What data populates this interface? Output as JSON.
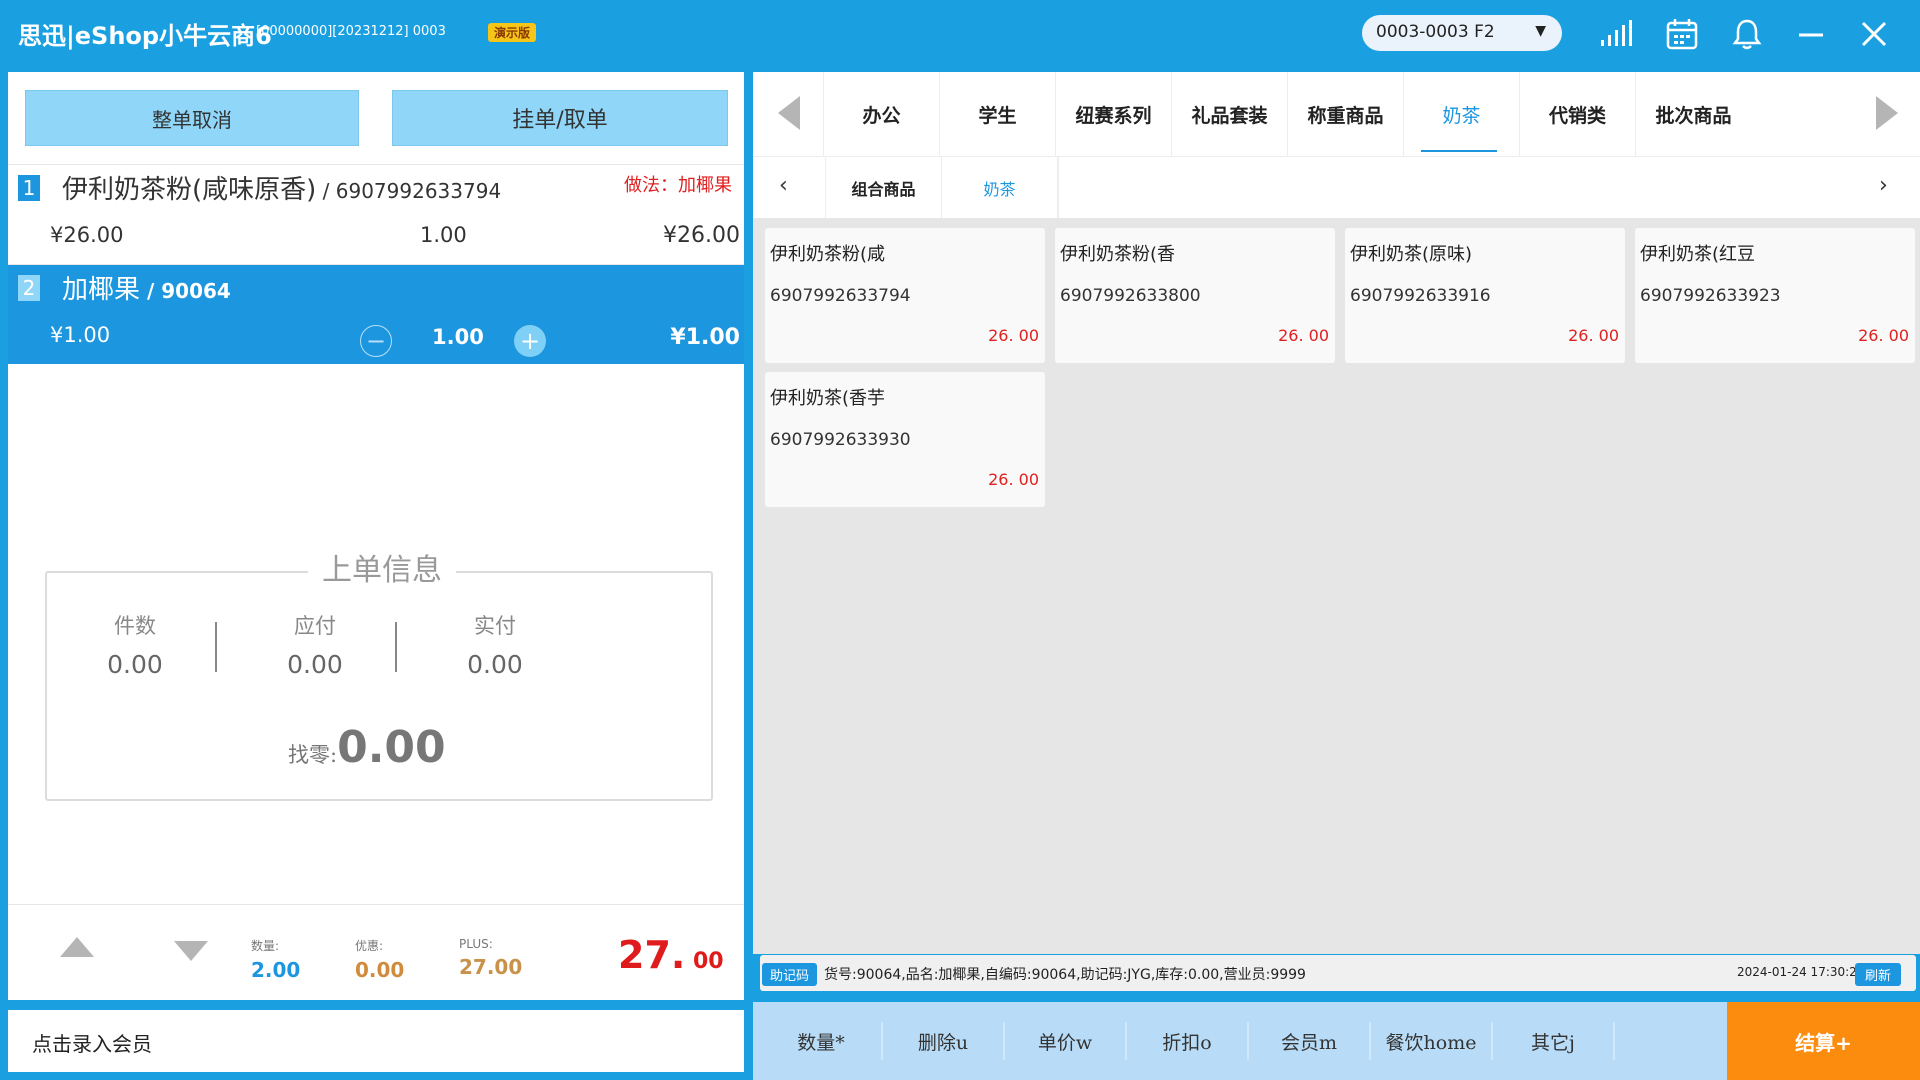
{
  "titlebar": {
    "app_title": "思迅|eShop小牛云商6",
    "meta": "[00000000][20231212]  0003",
    "demo_badge": "演示版",
    "store_select": "0003-0003 F2",
    "icons": [
      "signal-icon",
      "calendar-icon",
      "bell-icon",
      "minimize-icon",
      "close-icon"
    ]
  },
  "left": {
    "cancel_order": "整单取消",
    "hold_order": "挂单/取单",
    "order_items": [
      {
        "no": "1",
        "name": "伊利奶茶粉(咸味原香)",
        "code": " / 6907992633794",
        "note": "做法：加椰果",
        "price": "¥26.00",
        "qty": "1.00",
        "total": "¥26.00"
      },
      {
        "no": "2",
        "name": "加椰果",
        "code": " / 90064",
        "note": "",
        "price": "¥1.00",
        "qty": "1.00",
        "total": "¥1.00"
      }
    ],
    "last_order": {
      "title": "上单信息",
      "items_label": "件数",
      "items_value": "0.00",
      "payable_label": "应付",
      "payable_value": "0.00",
      "paid_label": "实付",
      "paid_value": "0.00",
      "change_label": "找零:",
      "change_value": "0.00"
    },
    "summary": {
      "qty_label": "数量:",
      "qty_value": "2.00",
      "discount_label": "优惠:",
      "discount_value": "0.00",
      "plus_label": "PLUS:",
      "plus_value": "27.00",
      "total_int": "27.",
      "total_dec": " 00"
    },
    "member_prompt": "点击录入会员"
  },
  "categories": {
    "tabs": [
      "办公",
      "学生",
      "纽赛系列",
      "礼品套装",
      "称重商品",
      "奶茶",
      "代销类",
      "批次商品"
    ],
    "active": "奶茶",
    "subtabs": [
      "组合商品",
      "奶茶"
    ],
    "active_sub": "奶茶"
  },
  "products": [
    {
      "name": "伊利奶茶粉(咸",
      "code": "6907992633794",
      "price": "26. 00"
    },
    {
      "name": "伊利奶茶粉(香",
      "code": "6907992633800",
      "price": "26. 00"
    },
    {
      "name": "伊利奶茶(原味)",
      "code": "6907992633916",
      "price": "26. 00"
    },
    {
      "name": "伊利奶茶(红豆",
      "code": "6907992633923",
      "price": "26. 00"
    },
    {
      "name": "伊利奶茶(香芋",
      "code": "6907992633930",
      "price": "26. 00"
    }
  ],
  "status": {
    "badge": "助记码",
    "text": "货号:90064,品名:加椰果,自编码:90064,助记码:JYG,库存:0.00,营业员:9999",
    "time": "2024-01-24 17:30:27",
    "refresh": "刷新"
  },
  "functions": [
    "数量*",
    "删除u",
    "单价w",
    "折扣o",
    "会员m",
    "餐饮home",
    "其它j"
  ],
  "checkout": "结算+",
  "colors": {
    "primary": "#1aa0e0",
    "accent_red": "#e02020",
    "checkout_orange": "#fb8c0d"
  }
}
